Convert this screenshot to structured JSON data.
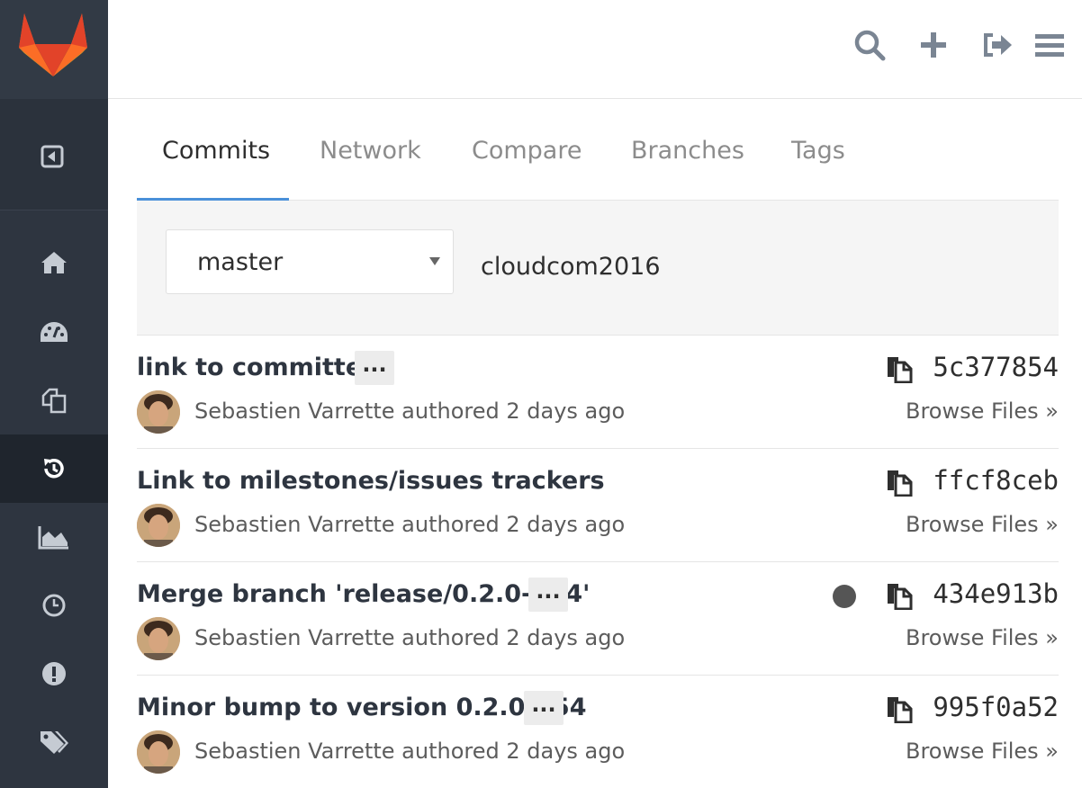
{
  "header": {
    "icons": [
      "search-icon",
      "plus-icon",
      "sign-out-icon",
      "hamburger-icon"
    ]
  },
  "sidebar": {
    "items": [
      {
        "icon": "home-icon"
      },
      {
        "icon": "dashboard-icon"
      },
      {
        "icon": "files-icon"
      },
      {
        "icon": "history-icon",
        "active": true
      },
      {
        "icon": "graph-icon"
      },
      {
        "icon": "clock-icon"
      },
      {
        "icon": "exclamation-icon"
      },
      {
        "icon": "tags-icon"
      }
    ]
  },
  "tabs": [
    {
      "label": "Commits",
      "active": true
    },
    {
      "label": "Network"
    },
    {
      "label": "Compare"
    },
    {
      "label": "Branches"
    },
    {
      "label": "Tags"
    }
  ],
  "filter": {
    "branch": "master",
    "project": "cloudcom2016"
  },
  "commits": [
    {
      "title": "link to committee",
      "has_ellipsis": true,
      "author_line": "Sebastien Varrette authored 2 days ago",
      "sha": "5c377854",
      "browse": "Browse Files »",
      "status": false
    },
    {
      "title": "Link to milestones/issues trackers",
      "has_ellipsis": false,
      "author_line": "Sebastien Varrette authored 2 days ago",
      "sha": "ffcf8ceb",
      "browse": "Browse Files »",
      "status": false
    },
    {
      "title": "Merge branch 'release/0.2.0-b54'",
      "has_ellipsis": true,
      "author_line": "Sebastien Varrette authored 2 days ago",
      "sha": "434e913b",
      "browse": "Browse Files »",
      "status": true
    },
    {
      "title": "Minor bump to version 0.2.0-b54",
      "has_ellipsis": true,
      "author_line": "Sebastien Varrette authored 2 days ago",
      "sha": "995f0a52",
      "browse": "Browse Files »",
      "status": false
    }
  ],
  "ellipsis_label": "...",
  "colors": {
    "sidebar_bg": "#2e3540",
    "active_tab_underline": "#4a90d9",
    "icon_gray": "#7a8593"
  }
}
